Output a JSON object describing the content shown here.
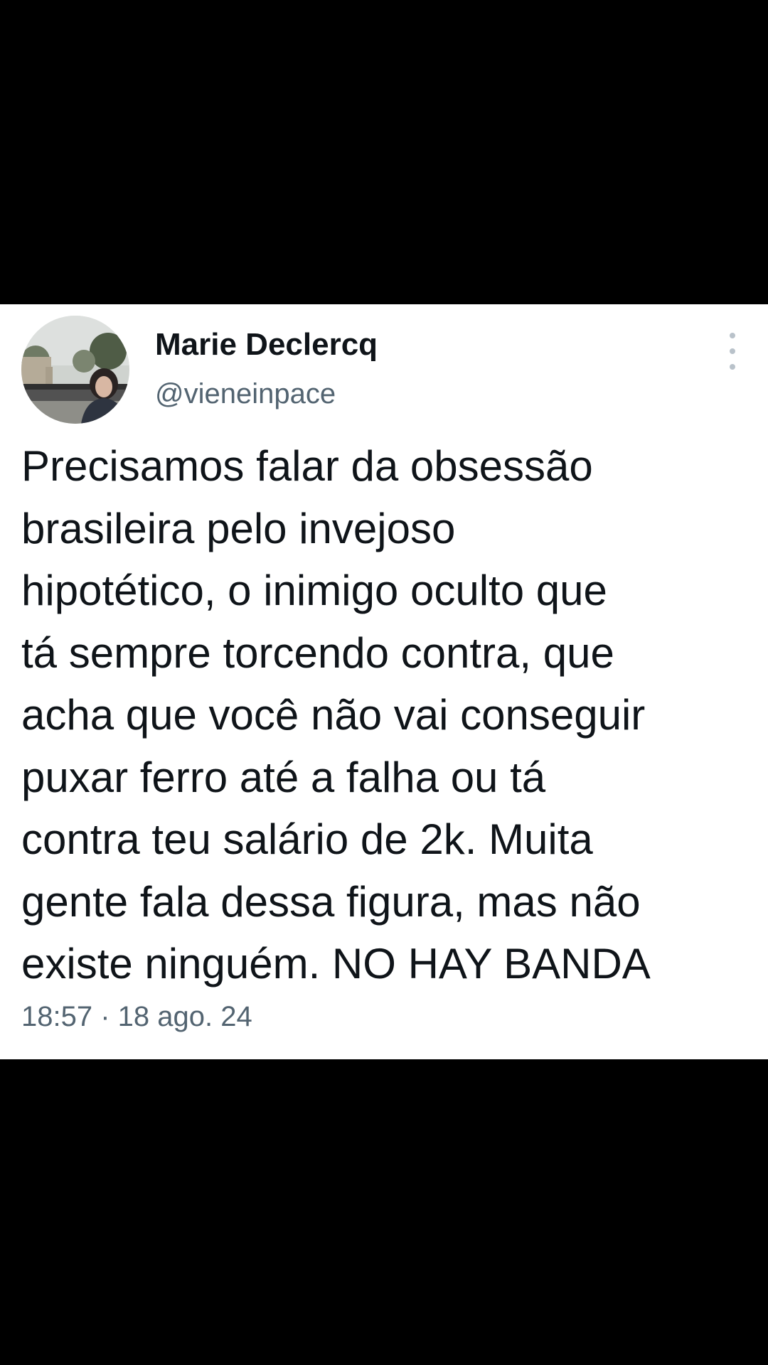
{
  "tweet": {
    "author": {
      "display_name": "Marie Declercq",
      "handle": "@vieneinpace",
      "avatar_icon": "user-photo-avatar"
    },
    "more_icon": "more-vertical-icon",
    "text_lines": [
      "Precisamos falar da obsessão",
      "brasileira pelo invejoso",
      "hipotético, o inimigo oculto que",
      "tá sempre torcendo contra, que",
      "acha que você não vai conseguir",
      "puxar ferro até a falha ou tá",
      "contra teu salário de 2k. Muita",
      "gente fala dessa figura, mas não",
      "existe ninguém. NO HAY BANDA"
    ],
    "timestamp": "18:57 · 18 ago. 24"
  },
  "colors": {
    "background": "#000000",
    "card": "#ffffff",
    "text_primary": "#0f1419",
    "text_secondary": "#536471"
  }
}
